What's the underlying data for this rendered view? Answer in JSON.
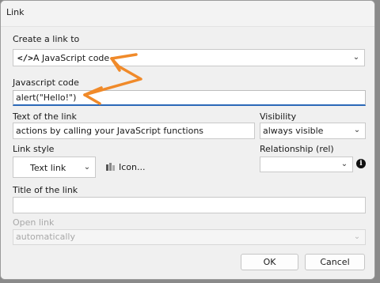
{
  "dialog": {
    "title": "Link"
  },
  "create_link": {
    "label": "Create a link to",
    "selected": "A JavaScript code",
    "icon": "code-icon"
  },
  "javascript_code": {
    "label": "Javascript code",
    "value": "alert(\"Hello!\")"
  },
  "link_text": {
    "label": "Text of the link",
    "value": "actions by calling your JavaScript functions"
  },
  "visibility": {
    "label": "Visibility",
    "selected": "always visible"
  },
  "link_style": {
    "label": "Link style",
    "selected": "Text link",
    "icon_button_label": "Icon..."
  },
  "relationship": {
    "label": "Relationship (rel)",
    "selected": ""
  },
  "link_title": {
    "label": "Title of the link",
    "value": ""
  },
  "open_link": {
    "label": "Open link",
    "selected": "automatically"
  },
  "buttons": {
    "ok": "OK",
    "cancel": "Cancel"
  },
  "colors": {
    "annotation_arrow": "#f08a2a",
    "focus_underline": "#2a68b8"
  }
}
